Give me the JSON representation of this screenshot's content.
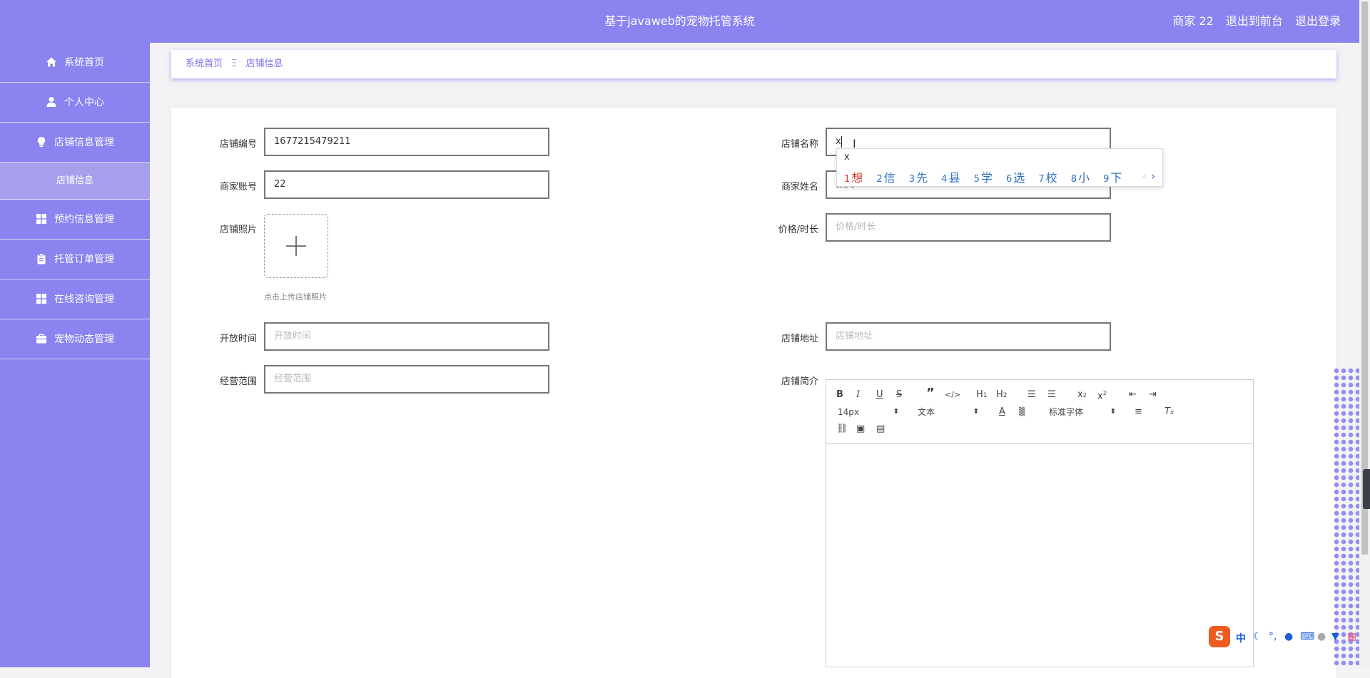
{
  "header": {
    "title": "基于javaweb的宠物托管系统",
    "user": "商家 22",
    "to_front": "退出到前台",
    "logout": "退出登录"
  },
  "sidebar": {
    "items": [
      {
        "label": "系统首页",
        "icon": "home-icon"
      },
      {
        "label": "个人中心",
        "icon": "user-icon"
      },
      {
        "label": "店铺信息管理",
        "icon": "bulb-icon"
      },
      {
        "label": "店铺信息",
        "icon": ""
      },
      {
        "label": "预约信息管理",
        "icon": "grid-icon"
      },
      {
        "label": "托管订单管理",
        "icon": "clipboard-icon"
      },
      {
        "label": "在线咨询管理",
        "icon": "grid-icon"
      },
      {
        "label": "宠物动态管理",
        "icon": "briefcase-icon"
      }
    ]
  },
  "breadcrumb": {
    "home": "系统首页",
    "separator": "Ξ",
    "current": "店铺信息"
  },
  "form": {
    "shop_no_label": "店铺编号",
    "shop_no_value": "1677215479211",
    "shop_name_label": "店铺名称",
    "shop_name_value": "x",
    "merchant_account_label": "商家账号",
    "merchant_account_value": "22",
    "merchant_name_label": "商家姓名",
    "merchant_name_value": "张美",
    "photo_label": "店铺照片",
    "photo_hint": "点击上传店铺照片",
    "price_label": "价格/时长",
    "price_placeholder": "价格/时长",
    "open_time_label": "开放时间",
    "open_time_placeholder": "开放时间",
    "address_label": "店铺地址",
    "address_placeholder": "店铺地址",
    "scope_label": "经营范围",
    "scope_placeholder": "经营范围",
    "intro_label": "店铺简介"
  },
  "editor": {
    "font_size": "14px",
    "block": "文本",
    "font_family": "标准字体"
  },
  "ime": {
    "pinyin": "x",
    "candidates": [
      {
        "n": "1",
        "w": "想"
      },
      {
        "n": "2",
        "w": "信"
      },
      {
        "n": "3",
        "w": "先"
      },
      {
        "n": "4",
        "w": "县"
      },
      {
        "n": "5",
        "w": "学"
      },
      {
        "n": "6",
        "w": "选"
      },
      {
        "n": "7",
        "w": "校"
      },
      {
        "n": "8",
        "w": "小"
      },
      {
        "n": "9",
        "w": "下"
      }
    ],
    "prev": "‹",
    "next": "›"
  },
  "ime_bar": {
    "logo": "S",
    "lang": "中"
  },
  "colors": {
    "brand": "#8a83f0",
    "brand_light": "#a6a0ec"
  }
}
